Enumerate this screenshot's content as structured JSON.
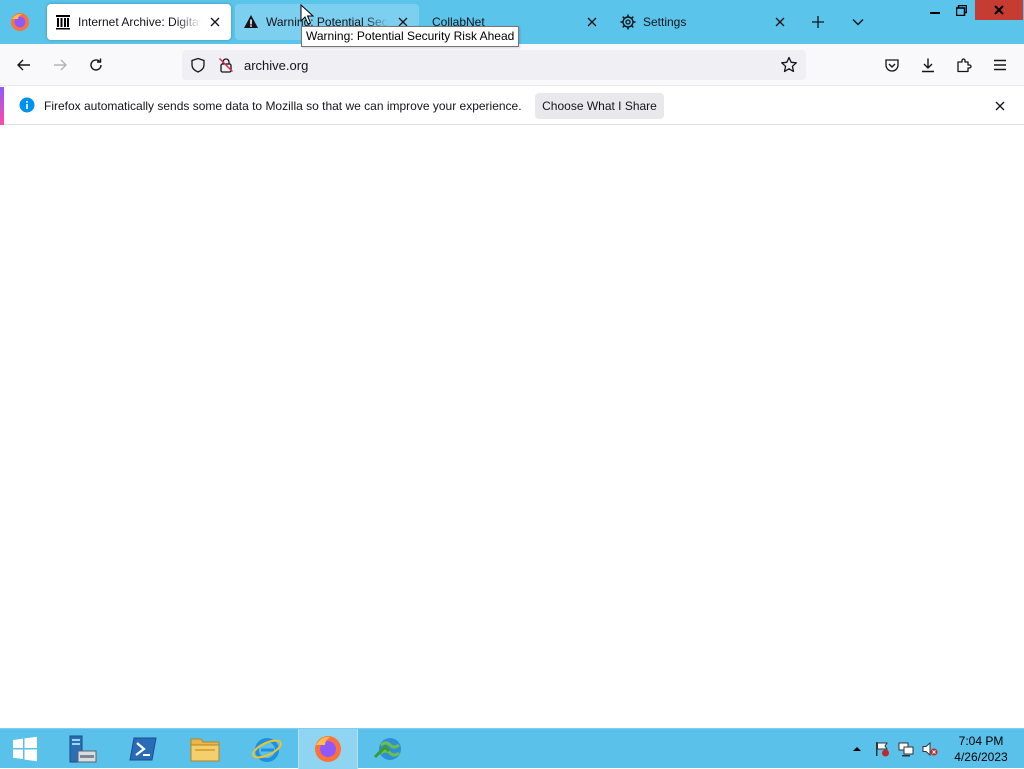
{
  "browser": {
    "tabs": [
      {
        "title": "Internet Archive: Digital Library of Free & Borrowable Books, Movies, Music & Wayback Machine",
        "icon": "archive-icon",
        "active": true
      },
      {
        "title": "Warning: Potential Security Risk Ahead",
        "icon": "warning-icon",
        "active": false
      },
      {
        "title": "CollabNet",
        "icon": "",
        "active": false
      },
      {
        "title": "Settings",
        "icon": "gear-icon",
        "active": false
      }
    ],
    "tooltip": "Warning: Potential Security Risk Ahead",
    "url": "archive.org",
    "notification": {
      "message": "Firefox automatically sends some data to Mozilla so that we can improve your experience.",
      "button_label": "Choose What I Share"
    }
  },
  "taskbar": {
    "apps": [
      "start-icon",
      "server-manager-icon",
      "powershell-icon",
      "file-explorer-icon",
      "internet-explorer-icon",
      "firefox-icon",
      "network-app-icon"
    ],
    "clock_time": "7:04 PM",
    "clock_date": "4/26/2023"
  },
  "colors": {
    "titlebar": "#5bc4ea",
    "taskbar": "#5ac1ea",
    "close_button": "#c73c32"
  }
}
